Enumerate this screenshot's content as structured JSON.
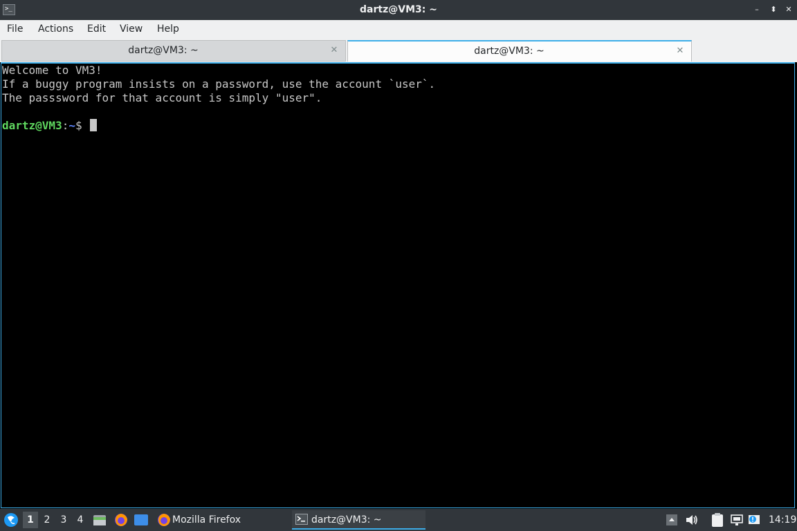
{
  "window": {
    "title": "dartz@VM3: ~",
    "buttons": {
      "minimize": "–",
      "maximize": "⬍",
      "close": "✕"
    }
  },
  "menu": [
    "File",
    "Actions",
    "Edit",
    "View",
    "Help"
  ],
  "tabs": [
    {
      "label": "dartz@VM3: ~",
      "active": false
    },
    {
      "label": "dartz@VM3: ~",
      "active": true
    }
  ],
  "terminal": {
    "lines": [
      "Welcome to VM3!",
      "If a buggy program insists on a password, use the account `user`.",
      "The passsword for that account is simply \"user\"."
    ],
    "prompt": {
      "user_host": "dartz@VM3",
      "separator": ":",
      "path": "~",
      "symbol": "$ "
    }
  },
  "taskbar": {
    "desktops": [
      "1",
      "2",
      "3",
      "4"
    ],
    "current_desktop": "1",
    "tasks": [
      {
        "label": "Mozilla Firefox",
        "active": false
      },
      {
        "label": "dartz@VM3: ~",
        "active": true
      }
    ],
    "clock": "14:19"
  },
  "colors": {
    "accent": "#3daee9",
    "panel": "#31363b",
    "prompt_user": "#5fd75f",
    "prompt_path": "#5f87ff"
  }
}
